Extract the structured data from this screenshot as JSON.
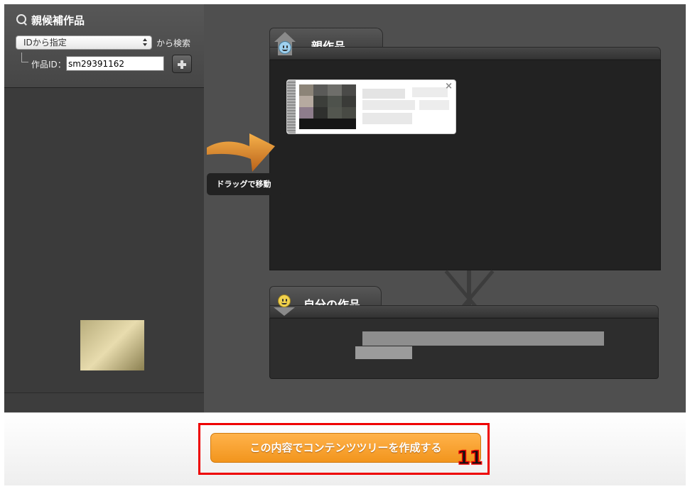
{
  "left_panel": {
    "title": "親候補作品",
    "select_value": "IDから指定",
    "search_label": "から検索",
    "id_label": "作品ID：",
    "id_value": "sm29391162"
  },
  "parent_panel": {
    "title": "親作品",
    "card_close": "×"
  },
  "drag_hint": {
    "label": "ドラッグで移動"
  },
  "own_panel": {
    "title": "自分の作品"
  },
  "footer": {
    "create_button": "この内容でコンテンツツリーを作成する",
    "step_number": "11"
  },
  "colors": {
    "accent_orange": "#f5a02a",
    "highlight_red": "#e00000",
    "panel_dark": "#222222",
    "background_gray": "#4f4f4f"
  },
  "icons": {
    "search": "search-icon",
    "plus": "plus-icon",
    "parent_face": "smiley-blue-icon",
    "own_face": "smiley-yellow-icon",
    "drag_arrow": "arrow-right-icon",
    "close": "close-icon"
  }
}
